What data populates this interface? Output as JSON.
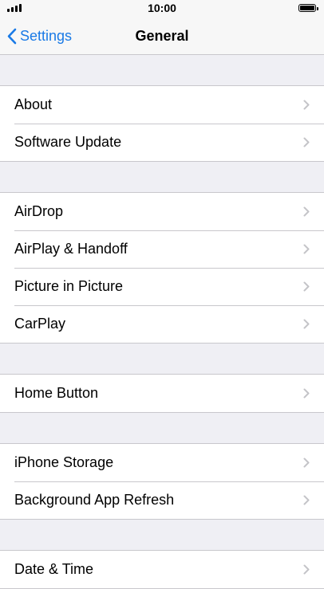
{
  "status_bar": {
    "time": "10:00"
  },
  "nav": {
    "back_label": "Settings",
    "title": "General"
  },
  "groups": [
    {
      "items": [
        {
          "label": "About"
        },
        {
          "label": "Software Update"
        }
      ]
    },
    {
      "items": [
        {
          "label": "AirDrop"
        },
        {
          "label": "AirPlay & Handoff"
        },
        {
          "label": "Picture in Picture"
        },
        {
          "label": "CarPlay"
        }
      ]
    },
    {
      "items": [
        {
          "label": "Home Button"
        }
      ]
    },
    {
      "items": [
        {
          "label": "iPhone Storage"
        },
        {
          "label": "Background App Refresh"
        }
      ]
    },
    {
      "items": [
        {
          "label": "Date & Time"
        }
      ]
    }
  ],
  "colors": {
    "accent": "#1a7ae6",
    "background": "#efeff4",
    "separator": "#c8c7cc"
  },
  "icons": [
    "signal-icon",
    "battery-icon",
    "chevron-left-icon",
    "chevron-right-icon"
  ]
}
